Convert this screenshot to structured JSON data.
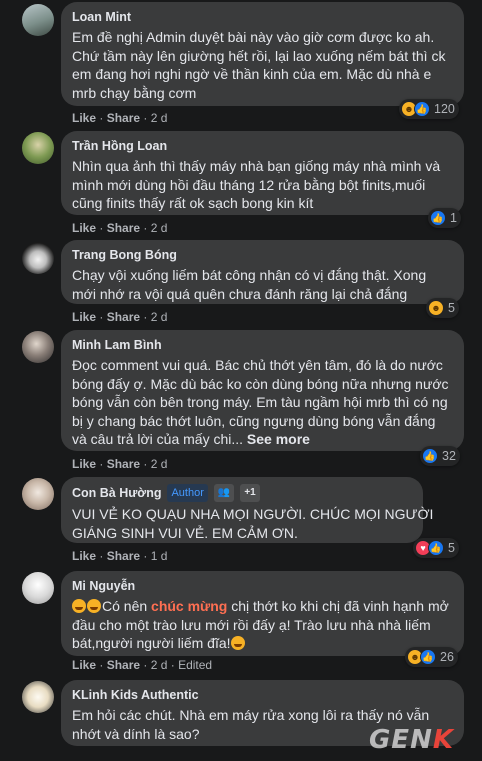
{
  "comments": [
    {
      "name": "Loan Mint",
      "lines": [
        "Em đề nghị Admin duyệt bài này vào giờ cơm được ko ah.",
        "Chứ tầm này lên giường hết rồi, lại lao xuống nếm bát thì ck",
        "em đang hơi nghi ngờ về thần kinh của em. Mặc dù nhà e",
        "mrb chạy bằng cơm"
      ],
      "like": "Like",
      "share": "Share",
      "time": "2 d",
      "reaction_count": "120"
    },
    {
      "name": "Trần Hồng Loan",
      "lines": [
        "Nhìn qua ảnh thì thấy máy nhà bạn giống máy nhà mình và",
        "mình mới dùng hồi đầu tháng 12 rửa bằng bột finits,muối",
        "cũng finits thấy rất ok sạch bong kin kít"
      ],
      "like": "Like",
      "share": "Share",
      "time": "2 d",
      "reaction_count": "1"
    },
    {
      "name": "Trang Bong Bóng",
      "lines": [
        "Chạy vội xuống liếm bát công nhận có vị đắng thật. Xong",
        "mới nhớ ra vội quá quên chưa đánh răng lại chả đắng"
      ],
      "like": "Like",
      "share": "Share",
      "time": "2 d",
      "reaction_count": "5"
    },
    {
      "name": "Minh Lam Bình",
      "lines": [
        "Đọc comment vui quá. Bác chủ thớt yên tâm, đó là do nước",
        "bóng đấy ợ. Mặc dù bác ko còn dùng bóng nữa nhưng nước",
        "bóng vẫn còn bên trong máy. Em tàu ngầm hội mrb thì có ng",
        "bị y chang bác thớt luôn, cũng ngưng dùng bóng vẫn đắng",
        "và câu trả lời của mấy chi..."
      ],
      "see_more": "See more",
      "like": "Like",
      "share": "Share",
      "time": "2 d",
      "reaction_count": "32"
    },
    {
      "name": "Con Bà Hường",
      "author_badge": "Author",
      "extra_badge": "+1",
      "lines": [
        "VUI VẺ KO QUẠU NHA MỌI NGƯỜI. CHÚC MỌI NGƯỜI",
        "GIÁNG SINH VUI VẺ. EM CẢM ƠN."
      ],
      "like": "Like",
      "share": "Share",
      "time": "1 d",
      "reaction_count": "5"
    },
    {
      "name": "Mi Nguyễn",
      "line1_a": "Có nên ",
      "line1_hl": "chúc mừng",
      "line1_b": " chị thớt ko khi chị đã vinh hạnh mở",
      "lines": [
        "đầu cho một trào lưu mới rồi đấy ạ! Trào lưu nhà nhà liếm",
        "bát,người người liếm đĩa!"
      ],
      "like": "Like",
      "share": "Share",
      "time": "2 d",
      "edited": "Edited",
      "reaction_count": "26"
    },
    {
      "name": "KLinh Kids Authentic",
      "lines": [
        "Em hỏi các chút. Nhà em máy rửa xong lôi ra thấy nó vẫn",
        "nhớt và dính là sao?"
      ]
    }
  ],
  "watermark": {
    "a": "GEN",
    "b": "K"
  },
  "colors": {
    "background": "#18191a",
    "bubble": "#3a3b3c",
    "like": "#1877f2",
    "haha": "#f7b125",
    "heart": "#f33e58",
    "highlight": "#ff6f52"
  }
}
